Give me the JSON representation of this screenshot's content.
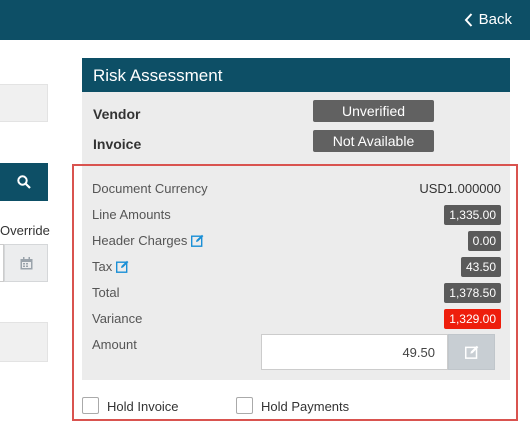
{
  "header": {
    "back_label": "Back"
  },
  "left": {
    "override_label": "Override"
  },
  "panel": {
    "title": "Risk Assessment",
    "vendor_label": "Vendor",
    "vendor_status": "Unverified",
    "invoice_label": "Invoice",
    "invoice_status": "Not Available",
    "rows": {
      "document_currency": {
        "label": "Document Currency",
        "value": "USD1.000000"
      },
      "line_amounts": {
        "label": "Line Amounts",
        "value": "1,335.00"
      },
      "header_charges": {
        "label": "Header Charges",
        "value": "0.00"
      },
      "tax": {
        "label": "Tax",
        "value": "43.50"
      },
      "total": {
        "label": "Total",
        "value": "1,378.50"
      },
      "variance": {
        "label": "Variance",
        "value": "1,329.00"
      },
      "amount": {
        "label": "Amount",
        "value": "49.50"
      }
    },
    "hold_invoice_label": "Hold Invoice",
    "hold_payments_label": "Hold Payments"
  },
  "colors": {
    "brand": "#0d4f66",
    "badge": "#5a5a5a",
    "variance": "#ee1e0c",
    "highlight_border": "#d9534f"
  }
}
